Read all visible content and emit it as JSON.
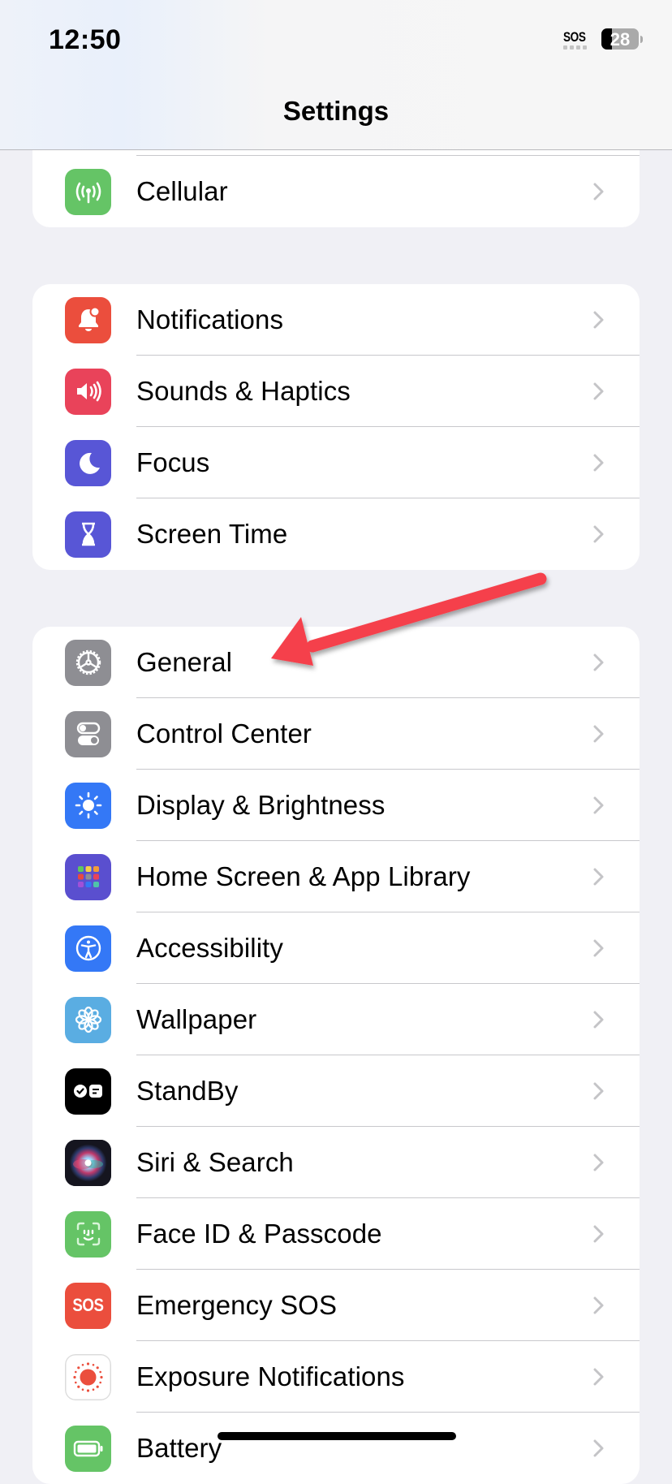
{
  "status_bar": {
    "time": "12:50",
    "signal_text": "SOS",
    "battery_percent": 28,
    "battery_label": "28"
  },
  "nav": {
    "title": "Settings"
  },
  "groups": [
    {
      "items": [
        {
          "label": "Cellular",
          "icon": "cellular-antenna-icon",
          "icon_color": "#65c466"
        }
      ]
    },
    {
      "items": [
        {
          "label": "Notifications",
          "icon": "bell-badge-icon",
          "icon_color": "#eb4e3d"
        },
        {
          "label": "Sounds & Haptics",
          "icon": "speaker-wave-icon",
          "icon_color": "#e9435a"
        },
        {
          "label": "Focus",
          "icon": "moon-icon",
          "icon_color": "#5856d6"
        },
        {
          "label": "Screen Time",
          "icon": "hourglass-icon",
          "icon_color": "#5856d6"
        }
      ]
    },
    {
      "items": [
        {
          "label": "General",
          "icon": "gear-icon",
          "icon_color": "#8e8e93"
        },
        {
          "label": "Control Center",
          "icon": "toggles-icon",
          "icon_color": "#8e8e93"
        },
        {
          "label": "Display & Brightness",
          "icon": "sun-icon",
          "icon_color": "#3478f6"
        },
        {
          "label": "Home Screen & App Library",
          "icon": "app-grid-icon",
          "icon_color": "#5a4fcf"
        },
        {
          "label": "Accessibility",
          "icon": "accessibility-person-icon",
          "icon_color": "#3478f6"
        },
        {
          "label": "Wallpaper",
          "icon": "flower-icon",
          "icon_color": "#5aade2"
        },
        {
          "label": "StandBy",
          "icon": "standby-clock-icon",
          "icon_color": "#000000"
        },
        {
          "label": "Siri & Search",
          "icon": "siri-orb-icon",
          "icon_color": "#1c1c2e"
        },
        {
          "label": "Face ID & Passcode",
          "icon": "face-id-icon",
          "icon_color": "#65c466"
        },
        {
          "label": "Emergency SOS",
          "icon": "sos-icon",
          "icon_color": "#eb4e3d",
          "icon_text": "SOS"
        },
        {
          "label": "Exposure Notifications",
          "icon": "exposure-dots-icon",
          "icon_color": "#ffffff"
        },
        {
          "label": "Battery",
          "icon": "battery-icon",
          "icon_color": "#65c466"
        }
      ]
    }
  ],
  "annotation": {
    "type": "arrow",
    "color": "#f5414b",
    "points_to": "General"
  },
  "colors": {
    "background": "#f0f0f5",
    "card": "#ffffff",
    "chevron": "#c4c4c7",
    "separator": "#c8c8cc"
  }
}
